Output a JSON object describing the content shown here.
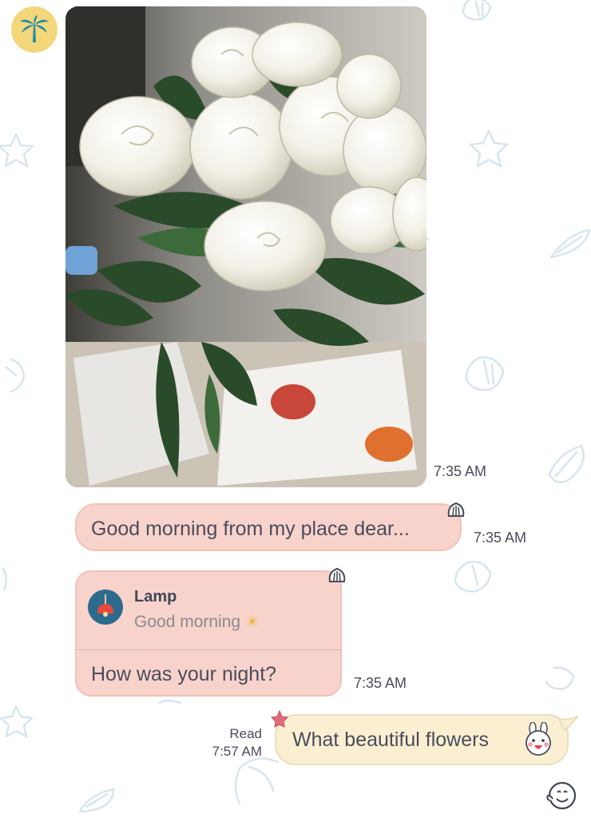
{
  "chat": {
    "contact_avatar_icon": "palm-tree-icon",
    "messages": [
      {
        "type": "image",
        "description_icon": "photo",
        "time": "7:35 AM"
      },
      {
        "type": "text",
        "text": "Good morning from my place dear...",
        "time": "7:35 AM",
        "reaction_icon": "shell-icon"
      },
      {
        "type": "reply",
        "reply_to_name": "Lamp",
        "reply_to_text": "Good morning",
        "text": "How was your night?",
        "time": "7:35 AM",
        "reaction_icon": "shell-icon"
      },
      {
        "type": "outgoing",
        "text": "What beautiful flowers",
        "status": "Read",
        "time": "7:57 AM",
        "reaction_icon": "star-icon"
      }
    ]
  },
  "colors": {
    "incoming_bubble": "#f8d3cc",
    "outgoing_bubble": "#fbefd2",
    "avatar_bg": "#f3d77a",
    "palm": "#1e8aa8",
    "wallpaper_doodles": "#d7e6ee"
  }
}
